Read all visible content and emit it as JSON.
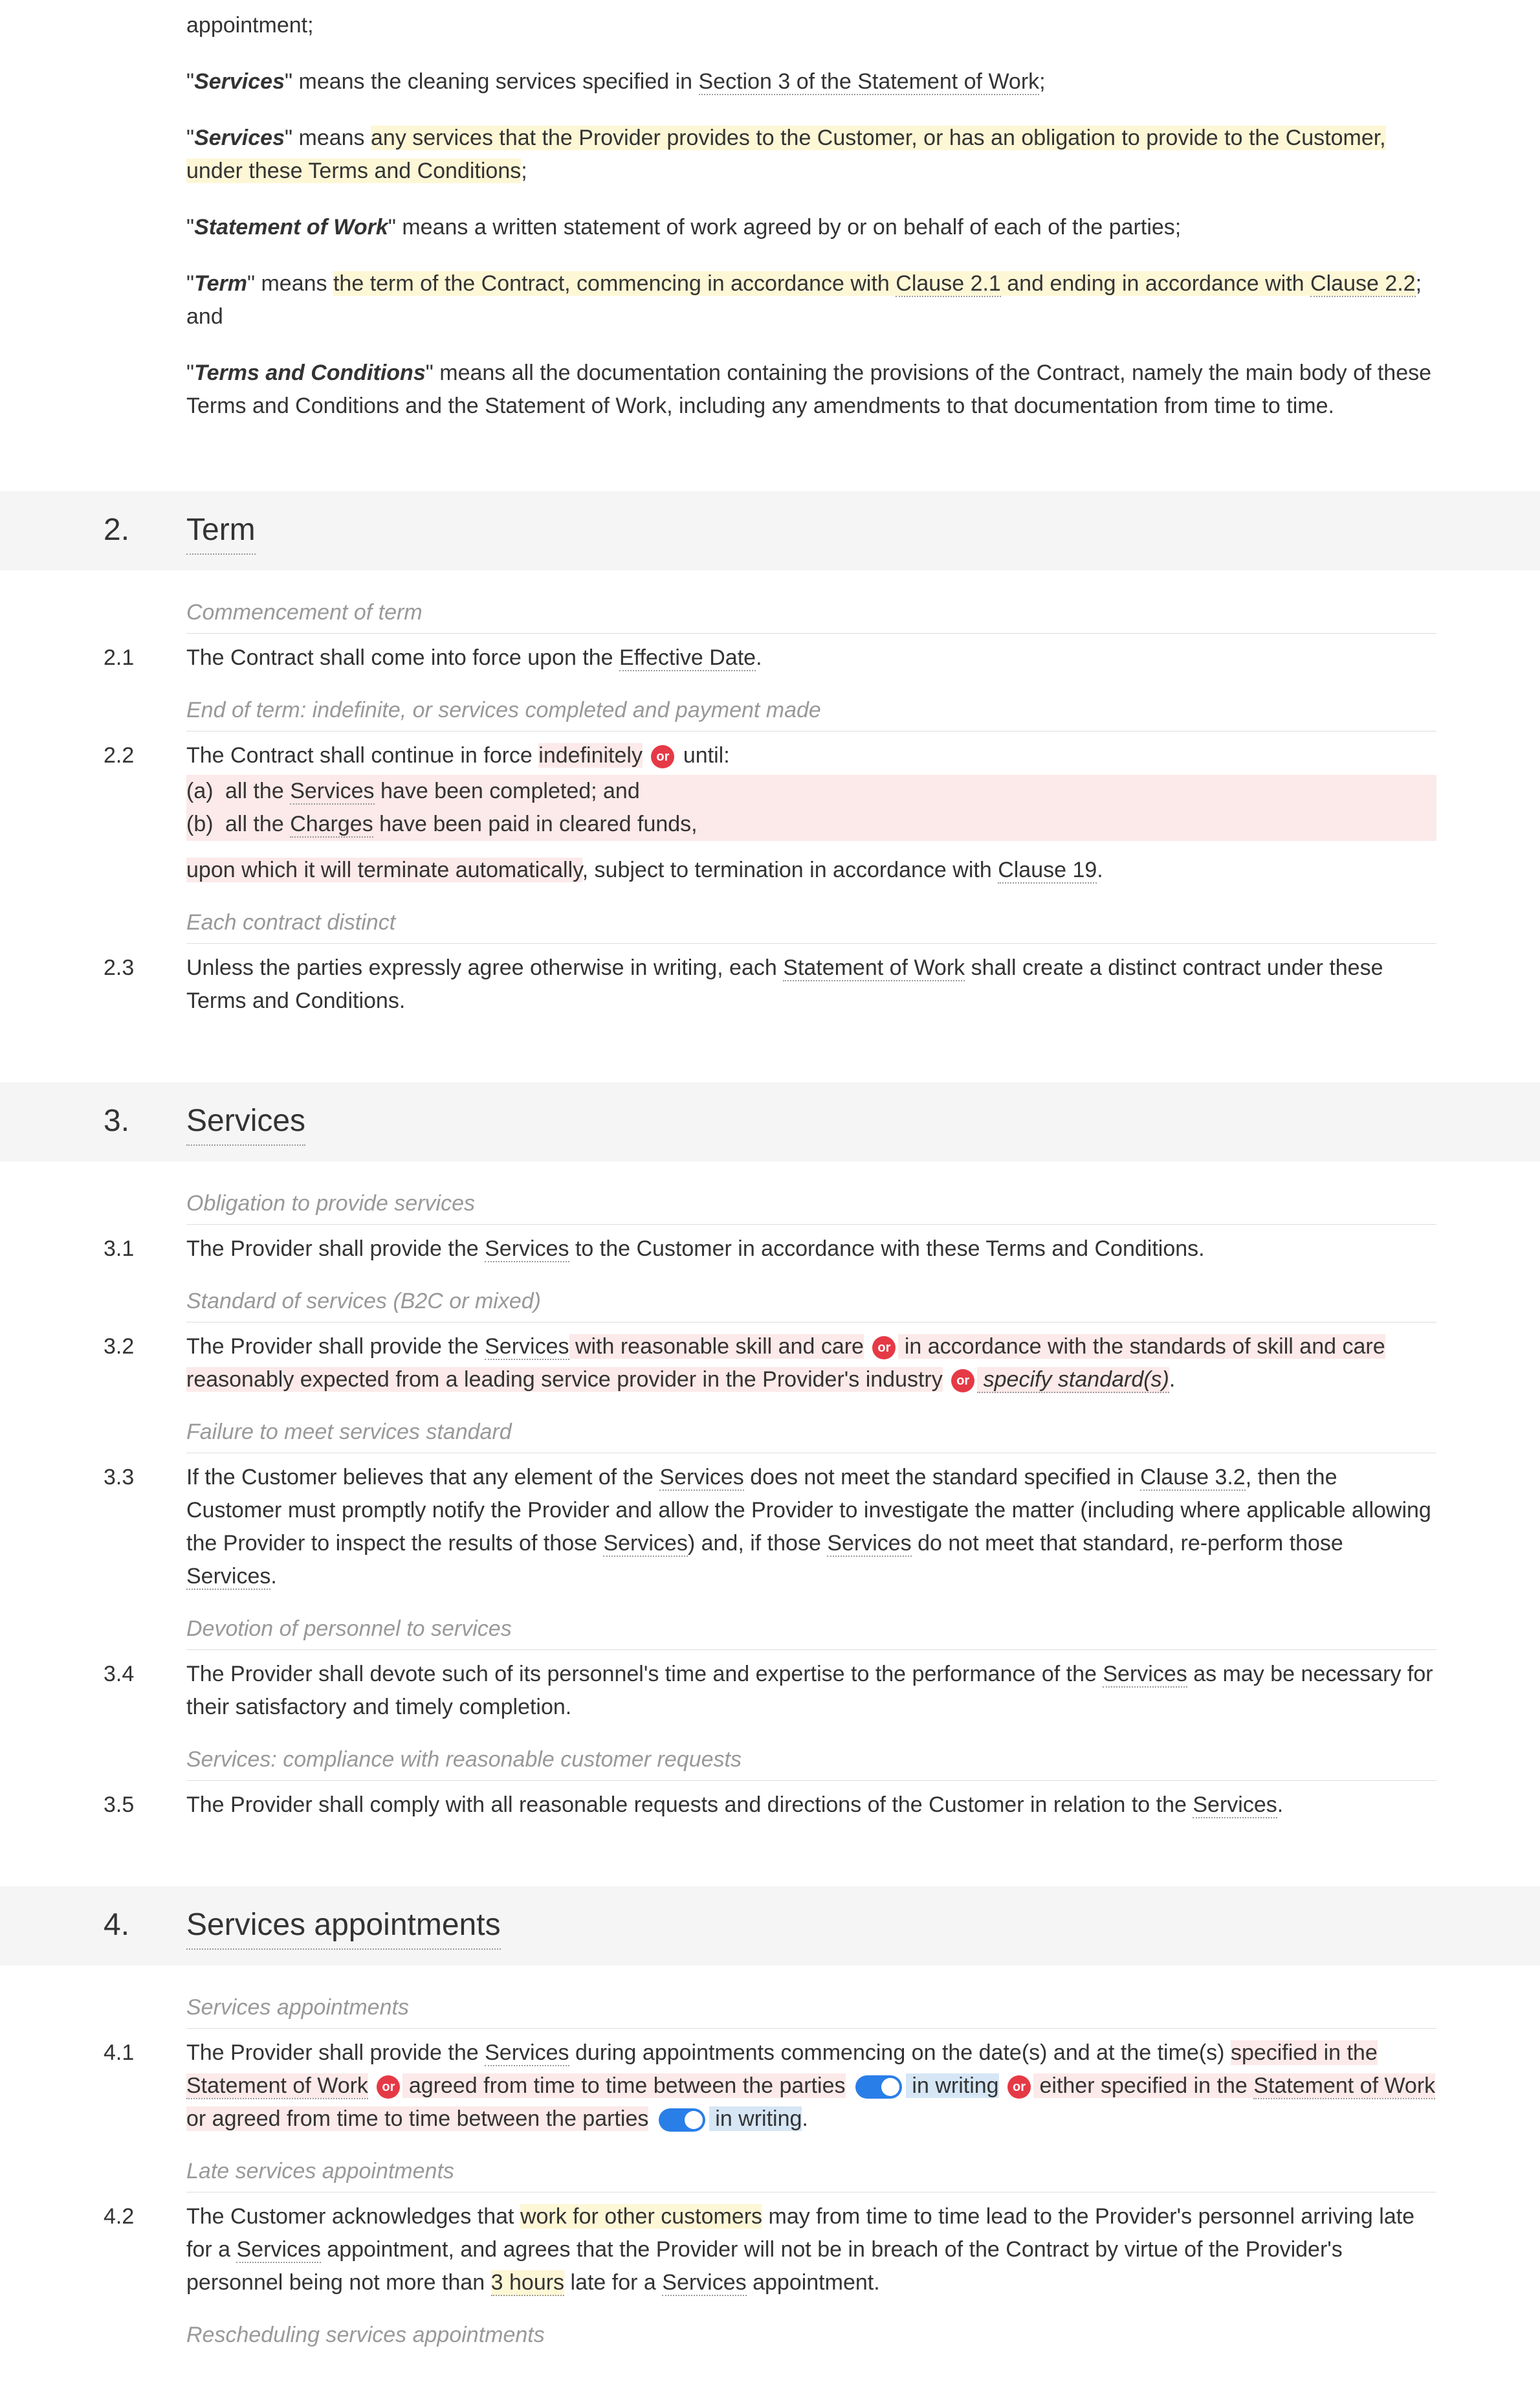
{
  "d1": {
    "tail": "appointment;"
  },
  "d2": {
    "term": "Services",
    "means": "\" means the cleaning services specified in ",
    "ref": "Section 3 of the Statement of Work",
    "tail": ";"
  },
  "d3": {
    "term": "Services",
    "means": "\" means ",
    "hl": "any services that the Provider provides to the Customer, or has an obligation to provide to the Customer, under these Terms and Conditions",
    "tail": ";"
  },
  "d4": {
    "term": "Statement of Work",
    "tail": "\" means a written statement of work agreed by or on behalf of each of the parties;"
  },
  "d5": {
    "term": "Term",
    "means": "\" means ",
    "hl1": "the term of the Contract, commencing in accordance with ",
    "ref1": "Clause 2.1",
    "mid": " and ending in accordance with ",
    "ref2": "Clause 2.2",
    "tail": "; and"
  },
  "d6": {
    "term": "Terms and Conditions",
    "tail": "\" means all the documentation containing the provisions of the Contract, namely the main body of these Terms and Conditions and the Statement of Work, including any amendments to that documentation from time to time."
  },
  "s2": {
    "num": "2.",
    "title": "Term"
  },
  "n21": "Commencement of term",
  "c21": {
    "num": "2.1",
    "p1": "The Contract shall come into force upon the ",
    "ref": "Effective Date",
    "p2": "."
  },
  "n22": "End of term: indefinite, or services completed and payment made",
  "c22": {
    "num": "2.2",
    "lead": "The Contract shall continue in force ",
    "indef": "indefinitely",
    "until": " until:",
    "a_marker": "(a)",
    "a": "all the ",
    "a_ref": "Services",
    "a_tail": " have been completed; and",
    "b_marker": "(b)",
    "b": "all the ",
    "b_ref": "Charges",
    "b_tail": " have been paid in cleared funds,",
    "upon": "upon which it will terminate automatically",
    "subj": ", subject to termination in accordance with ",
    "ref": "Clause 19",
    "dot": "."
  },
  "n23": "Each contract distinct",
  "c23": {
    "num": "2.3",
    "p1": "Unless the parties expressly agree otherwise in writing, each ",
    "ref": "Statement of Work",
    "p2": " shall create a distinct contract under these Terms and Conditions."
  },
  "s3": {
    "num": "3.",
    "title": "Services"
  },
  "n31": "Obligation to provide services",
  "c31": {
    "num": "3.1",
    "p1": "The Provider shall provide the ",
    "ref": "Services",
    "p2": " to the Customer in accordance with these Terms and Conditions."
  },
  "n32": "Standard of services (B2C or mixed)",
  "c32": {
    "num": "3.2",
    "p1": "The Provider shall provide the ",
    "ref": "Services",
    "opt1": " with reasonable skill and care",
    "opt2": " in accordance with the standards of skill and care reasonably expected from a leading service provider in the Provider's industry",
    "fill": " specify standard(s)",
    "dot": "."
  },
  "n33": "Failure to meet services standard",
  "c33": {
    "num": "3.3",
    "p1": "If the Customer believes that any element of the ",
    "ref1": "Services",
    "p2": " does not meet the standard specified in ",
    "ref2": "Clause 3.2",
    "p3": ", then the Customer must promptly notify the Provider and allow the Provider to investigate the matter (including where applicable allowing the Provider to inspect the results of those ",
    "ref3": "Services",
    "p4": ") and, if those ",
    "ref4": "Services",
    "p5": " do not meet that standard, re-perform those ",
    "ref5": "Services",
    "p6": "."
  },
  "n34": "Devotion of personnel to services",
  "c34": {
    "num": "3.4",
    "p1": "The Provider shall devote such of its personnel's time and expertise to the performance of the ",
    "ref": "Services",
    "p2": " as may be necessary for their satisfactory and timely completion."
  },
  "n35": "Services: compliance with reasonable customer requests",
  "c35": {
    "num": "3.5",
    "p1": "The Provider shall comply with all reasonable requests and directions of the Customer in relation to the ",
    "ref": "Services",
    "p2": "."
  },
  "s4": {
    "num": "4.",
    "title": "Services appointments"
  },
  "n41": "Services appointments",
  "c41": {
    "num": "4.1",
    "p1": "The Provider shall provide the ",
    "ref1": "Services",
    "p2": " during appointments commencing on the date(s) and at the time(s) ",
    "opt1a": "specified in the ",
    "sow1": "Statement of Work",
    "opt1b": " agreed from time to time between the parties",
    "inw": " in writing",
    "opt2a": " either specified in the ",
    "sow2": "Statement of Work",
    "opt2b": " or agreed from time to time between the parties",
    "dot": "."
  },
  "n42": "Late services appointments",
  "c42": {
    "num": "4.2",
    "p1": "The Customer acknowledges that ",
    "hl": "work for other customers",
    "p2": " may from time to time lead to the Provider's personnel arriving late for a ",
    "ref1": "Services",
    "p3": " appointment, and agrees that the Provider will not be in breach of the Contract by virtue of the Provider's personnel being not more than ",
    "hrs": "3 hours",
    "p4": " late for a ",
    "ref2": "Services",
    "p5": " appointment."
  },
  "n43": "Rescheduling services appointments",
  "or": "or"
}
